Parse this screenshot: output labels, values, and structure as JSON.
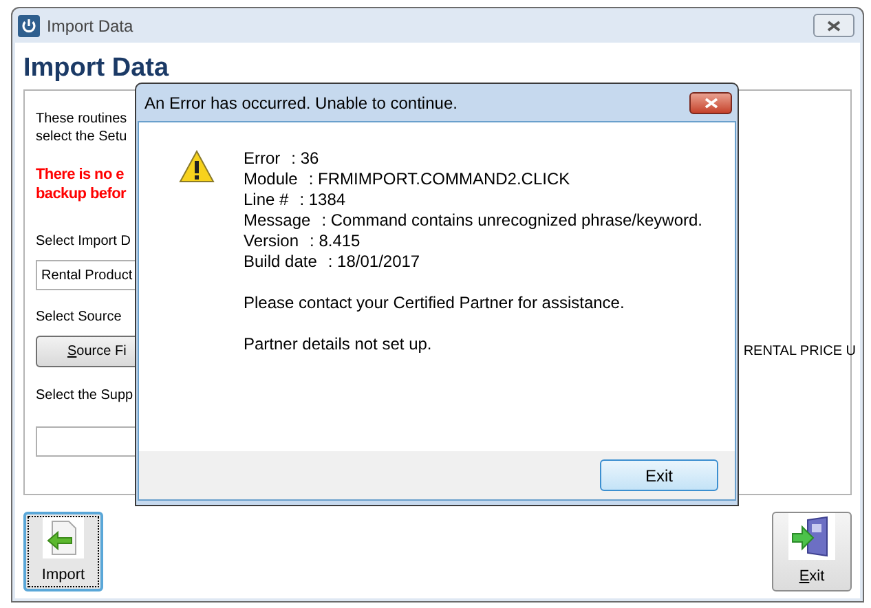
{
  "main_window": {
    "title": "Import Data",
    "heading": "Import Data",
    "intro_lines": [
      "These routines",
      "select the Setu"
    ],
    "warning_lines": [
      "There is no e",
      "backup befor"
    ],
    "import_type_label": "Select Import D",
    "import_type_value": "Rental Product",
    "source_label": "Select Source",
    "source_button": {
      "label": "Source Fi",
      "first_letter_underlined": true
    },
    "source_path": "RENTAL PRICE U",
    "supplier_label": "Select the Supp",
    "buttons": [
      {
        "kind": "import",
        "label": "Import",
        "focused": true
      },
      {
        "kind": "exit",
        "label": "Exit",
        "first_letter_underlined": true,
        "focused": false
      }
    ]
  },
  "error_dialog": {
    "title": "An Error has occurred. Unable to continue.",
    "details": [
      {
        "label": "Error",
        "value": ": 36"
      },
      {
        "label": "Module",
        "value": ": FRMIMPORT.COMMAND2.CLICK"
      },
      {
        "label": "Line #",
        "value": ": 1384"
      },
      {
        "label": "Message",
        "value": ": Command contains unrecognized phrase/keyword."
      },
      {
        "label": "Version",
        "value": ": 8.415"
      },
      {
        "label": "Build date",
        "value": ": 18/01/2017"
      }
    ],
    "messages": [
      "Please contact your Certified Partner for assistance.",
      "Partner details not set up."
    ],
    "button": "Exit"
  }
}
